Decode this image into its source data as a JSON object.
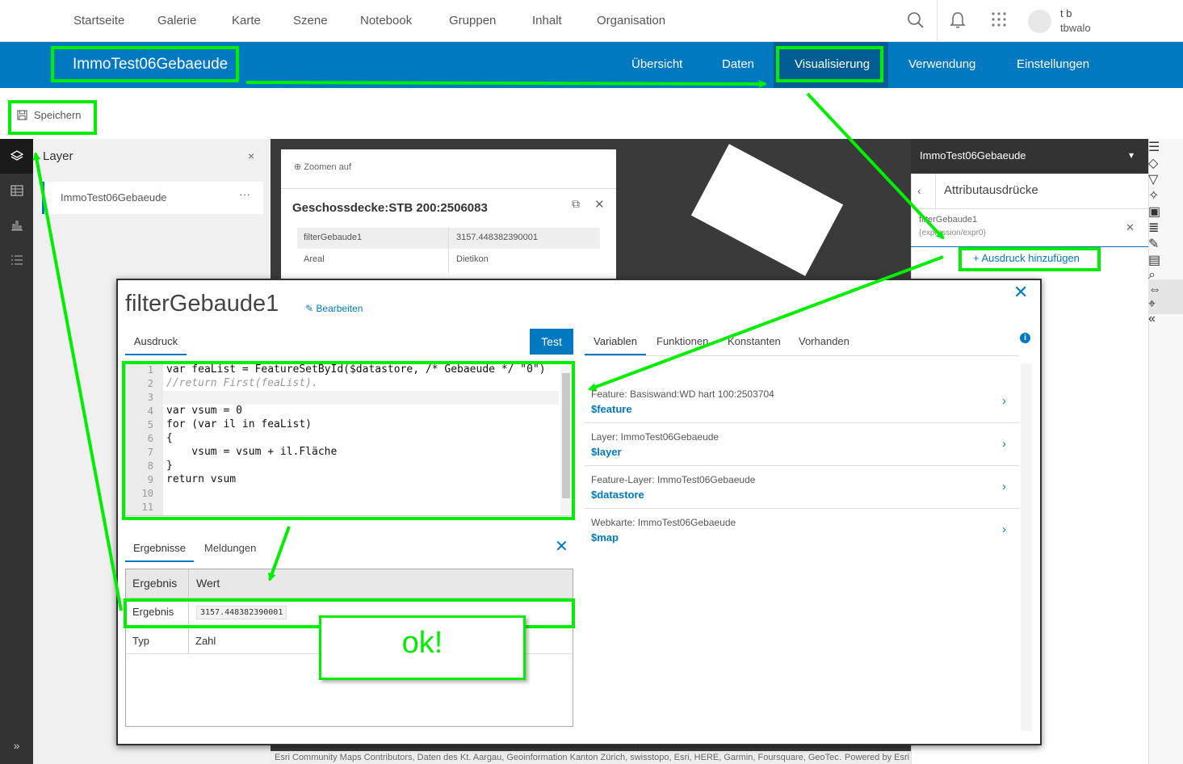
{
  "topnav": {
    "links": [
      "Startseite",
      "Galerie",
      "Karte",
      "Szene",
      "Notebook",
      "Gruppen",
      "Inhalt",
      "Organisation"
    ],
    "icons": [
      "search-icon",
      "bell-icon",
      "apps-grid-icon"
    ],
    "user_name": "t b",
    "user_id": "tbwalo"
  },
  "item": {
    "title": "ImmoTest06Gebaeude",
    "tabs": [
      "Übersicht",
      "Daten",
      "Visualisierung",
      "Verwendung",
      "Einstellungen"
    ],
    "active_tab": "Visualisierung"
  },
  "toolbar": {
    "save_label": "Speichern"
  },
  "layers": {
    "title": "Layer",
    "close": "×",
    "items": [
      {
        "name": "ImmoTest06Gebaeude",
        "more": "···"
      }
    ]
  },
  "popup": {
    "zoom_label": "Zoomen auf",
    "title": "Geschossdecke:STB 200:2506083",
    "rows": [
      {
        "field": "filterGebaude1",
        "value": "3157.448382390001"
      },
      {
        "field": "Areal",
        "value": "Dietikon"
      }
    ]
  },
  "map": {
    "attribution": "Esri Community Maps Contributors, Daten des Kt. Aargau, Geoinformation Kanton Zürich, swisstopo, Esri, HERE, Garmin, Foursquare, GeoTec…",
    "powered_by": "Powered by Esri"
  },
  "right_panel": {
    "header": "ImmoTest06Gebaeude",
    "subtitle": "Attributausdrücke",
    "expression_name": "filterGebaude1",
    "expression_id": "{expression/expr0}",
    "add_label": "+   Ausdruck hinzufügen"
  },
  "dialog": {
    "title": "filterGebaude1",
    "edit_label": "Bearbeiten",
    "tab_expression": "Ausdruck",
    "test_label": "Test",
    "line_numbers": [
      "1",
      "2",
      "3",
      "4",
      "5",
      "6",
      "7",
      "8",
      "9",
      "10",
      "11"
    ],
    "code_lines": [
      "var feaList = FeatureSetById($datastore, /* Gebaeude */ \"0\")",
      "//return First(feaList).",
      "",
      "var vsum = 0",
      "for (var il in feaList)",
      "{",
      "    vsum = vsum + il.Fläche",
      "}",
      "return vsum",
      "",
      ""
    ],
    "results_tabs": [
      "Ergebnisse",
      "Meldungen"
    ],
    "results": {
      "headers": [
        "Ergebnis",
        "Wert"
      ],
      "rows": [
        {
          "label": "Ergebnis",
          "value": "3157.448382390001"
        },
        {
          "label": "Typ",
          "value": "Zahl"
        }
      ]
    },
    "var_tabs": [
      "Variablen",
      "Funktionen",
      "Konstanten",
      "Vorhanden"
    ],
    "variables": [
      {
        "label": "Feature: Basiswand:WD hart 100:2503704",
        "name": "$feature"
      },
      {
        "label": "Layer: ImmoTest06Gebaeude",
        "name": "$layer"
      },
      {
        "label": "Feature-Layer: ImmoTest06Gebaeude",
        "name": "$datastore"
      },
      {
        "label": "Webkarte: ImmoTest06Gebaeude",
        "name": "$map"
      }
    ]
  },
  "annotation": {
    "ok_text": "ok!",
    "color": "#00ee00"
  },
  "colors": {
    "brand_blue": "#0079c1",
    "active_tab_bg": "#005e95",
    "sidebar_dark": "#333333"
  }
}
